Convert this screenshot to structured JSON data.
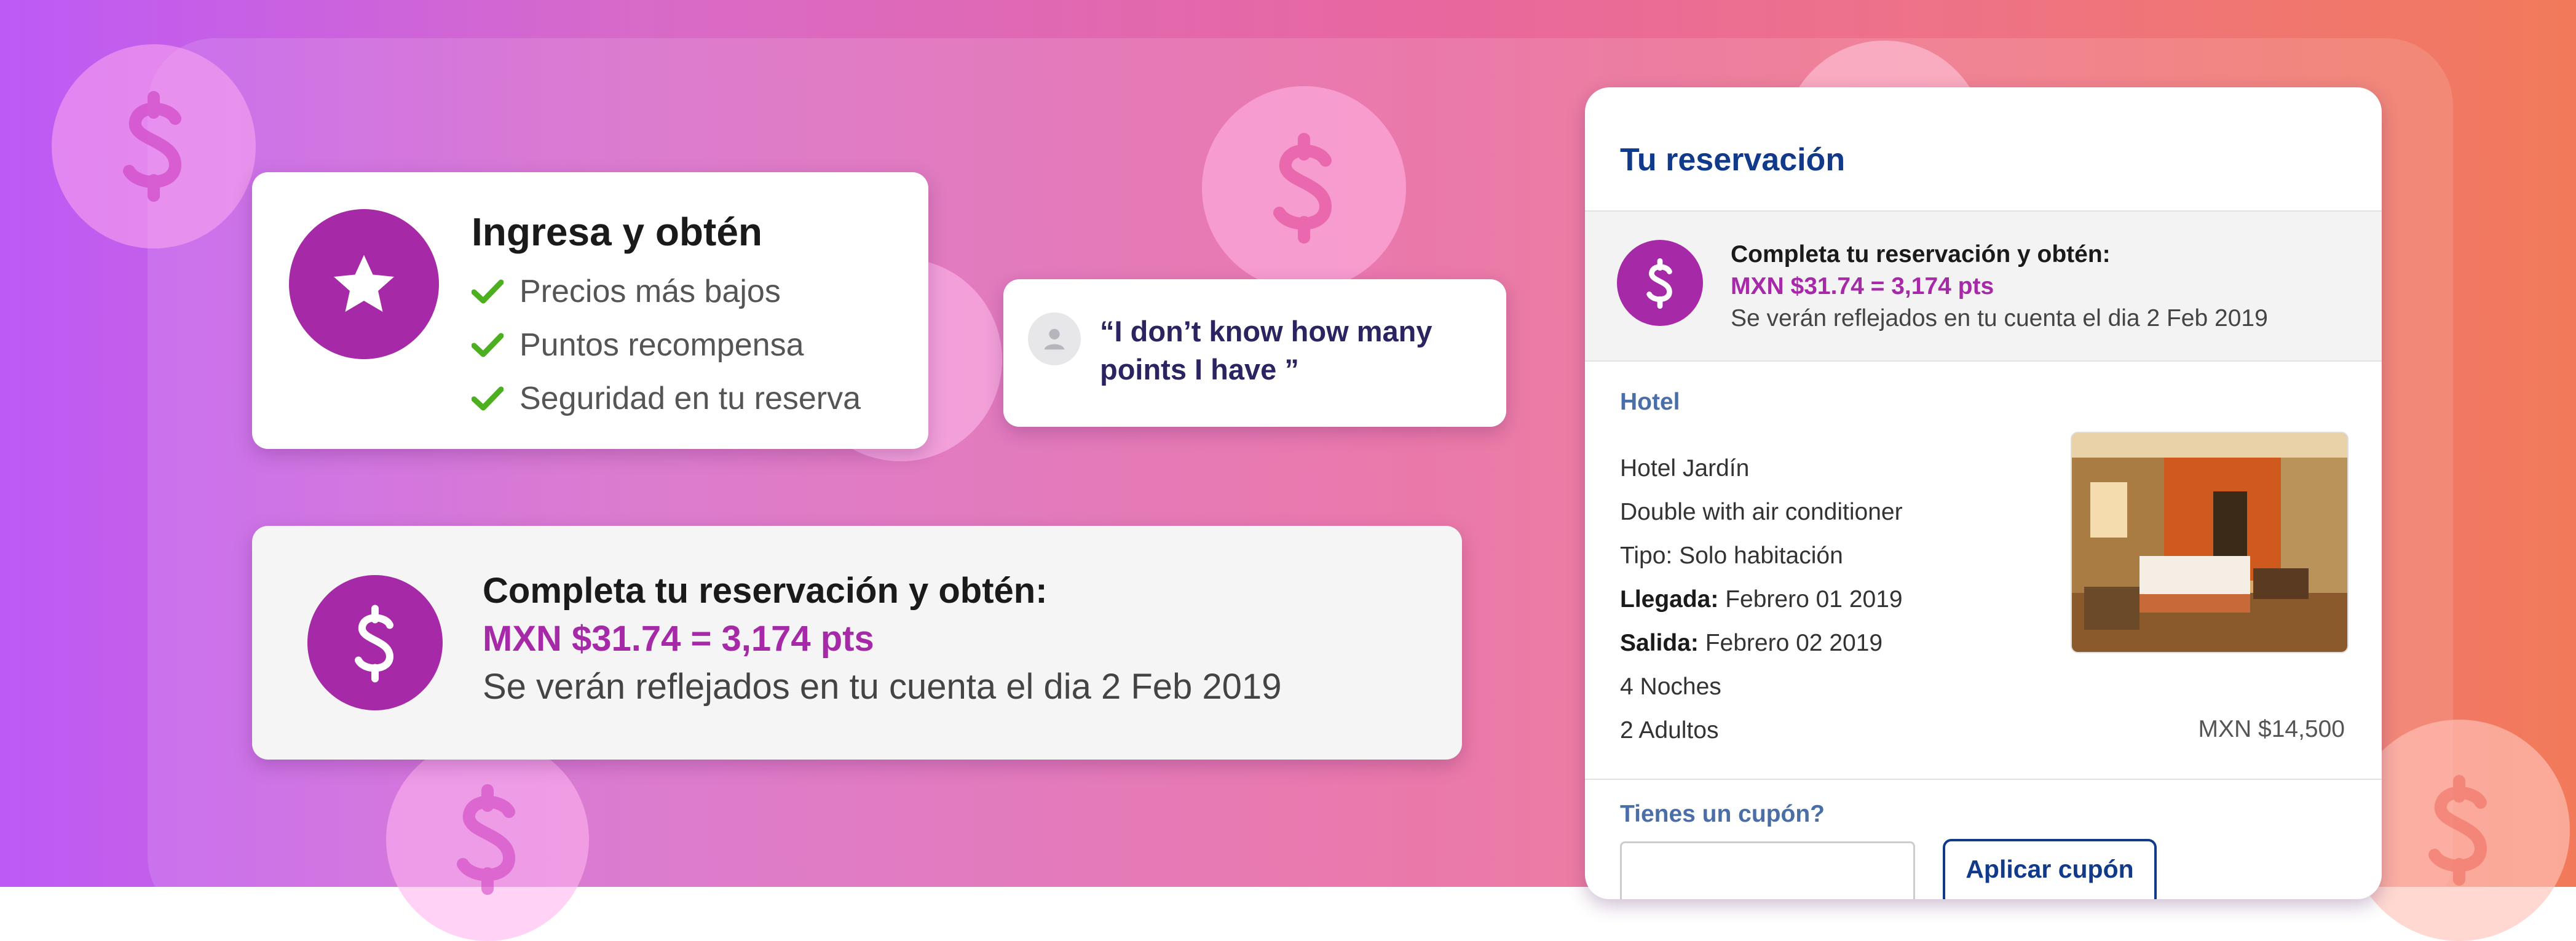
{
  "login_card": {
    "title": "Ingresa y obtén",
    "benefits": [
      {
        "label": "Precios más bajos"
      },
      {
        "label": "Puntos recompensa"
      },
      {
        "label": "Seguridad en tu reserva"
      }
    ]
  },
  "quote": {
    "text": "“I don’t know how many points I have ”"
  },
  "banner": {
    "heading": "Completa tu reservación y obtén:",
    "points": "MXN $31.74 = 3,174 pts",
    "note": "Se verán reflejados en tu cuenta el dia 2 Feb 2019"
  },
  "reservation": {
    "title": "Tu reservación",
    "earn": {
      "heading": "Completa tu reservación y obtén:",
      "points": "MXN $31.74 = 3,174 pts",
      "note": "Se verán reflejados en tu cuenta el dia 2 Feb 2019"
    },
    "section_label": "Hotel",
    "hotel_name": "Hotel Jardín",
    "room": "Double with air conditioner",
    "type": "Tipo: Solo habitación",
    "arrival_label": "Llegada:",
    "arrival_value": " Febrero 01 2019",
    "departure_label": "Salida:",
    "departure_value": " Febrero 02 2019",
    "nights": "4 Noches",
    "adults": "2 Adultos",
    "price": "MXN $14,500",
    "coupon_label": "Tienes un cupón?",
    "coupon_value": "",
    "apply_button": "Aplicar cupón"
  },
  "colors": {
    "brand_purple": "#a62aa8",
    "navy": "#123a8a",
    "check_green": "#4caf20"
  }
}
